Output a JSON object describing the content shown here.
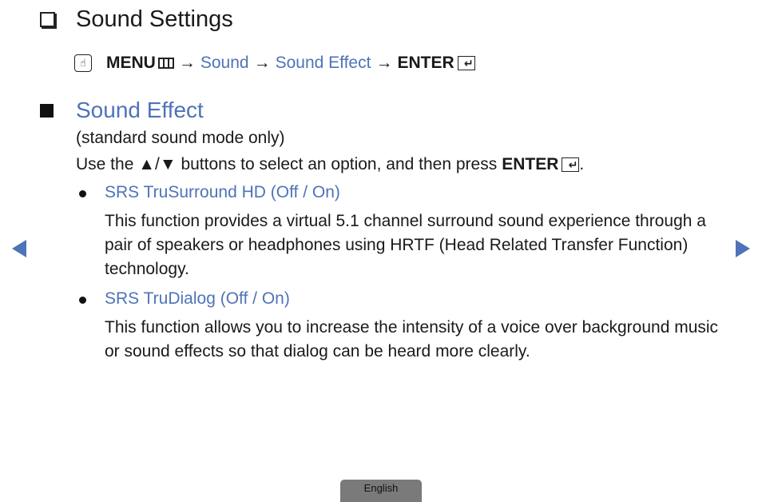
{
  "header": {
    "title": "Sound Settings"
  },
  "menu_path": {
    "menu_label": "MENU",
    "arrow": "→",
    "step1": "Sound",
    "step2": "Sound Effect",
    "enter_label": "ENTER",
    "touch_icon": "touch-remote-icon",
    "menu_icon": "menu-grid-icon",
    "enter_icon": "enter-key-icon"
  },
  "section": {
    "title": "Sound Effect",
    "note": "(standard sound mode only)",
    "instruction": "Use the ▲/▼ buttons to select an option, and then press",
    "instruction_enter": "ENTER",
    "instruction_end": ".",
    "items": [
      {
        "title": "SRS TruSurround HD (Off / On)",
        "description": "This function provides a virtual 5.1 channel surround sound experience through a pair of speakers or headphones using HRTF (Head Related Transfer Function) technology."
      },
      {
        "title": "SRS TruDialog (Off / On)",
        "description": "This function allows you to increase the intensity of a voice over background music or sound effects so that dialog can be heard more clearly."
      }
    ]
  },
  "navigation": {
    "prev_icon": "previous-page-icon",
    "next_icon": "next-page-icon"
  },
  "footer": {
    "language": "English"
  },
  "colors": {
    "link_blue": "#4e73b8",
    "text": "#1a1a1a",
    "language_tab": "#7a7a7a"
  }
}
